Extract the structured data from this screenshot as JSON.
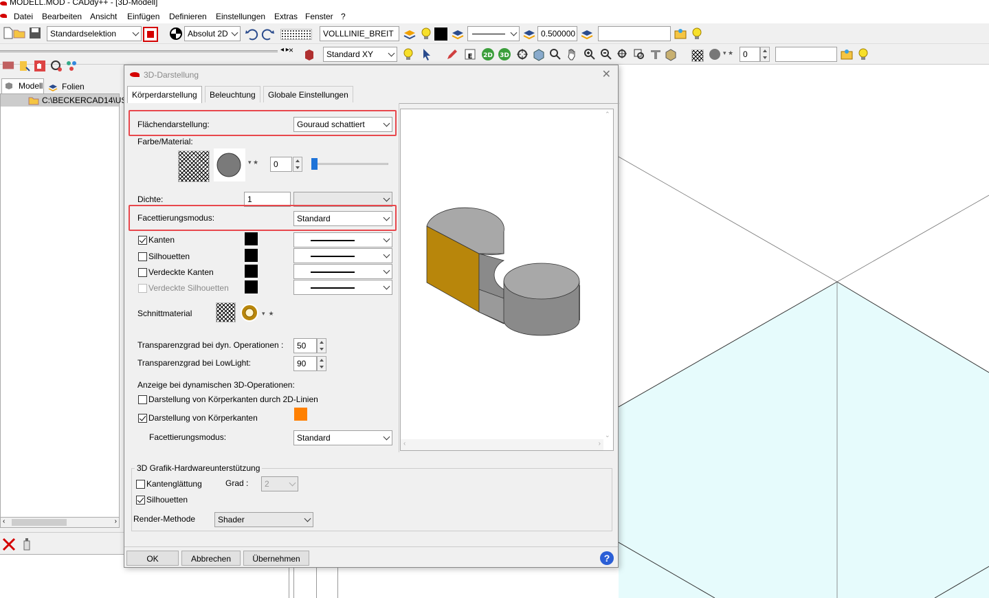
{
  "app": {
    "title": "MODELL.MOD  -  CADdy++ - [3D-Modell]"
  },
  "menu": [
    "Datei",
    "Bearbeiten",
    "Ansicht",
    "Einfügen",
    "Definieren",
    "Einstellungen",
    "Extras",
    "Fenster",
    "?"
  ],
  "toolbar": {
    "selection": "Standardselektion",
    "coord_mode": "Absolut 2D",
    "linestyle": "VOLLLINIE_BREIT",
    "linewidth": "0.500000",
    "view": "Standard XY",
    "layer_value": "0"
  },
  "left_panel": {
    "tabs": [
      "Modell",
      "Folien"
    ],
    "tree_item": "C:\\BECKERCAD14\\US"
  },
  "dialog": {
    "title": "3D-Darstellung",
    "tabs": [
      "Körperdarstellung",
      "Beleuchtung",
      "Globale Einstellungen"
    ],
    "flaechen_label": "Flächendarstellung:",
    "flaechen_value": "Gouraud schattiert",
    "farbe_label": "Farbe/Material:",
    "farbe_value": "0",
    "dichte_label": "Dichte:",
    "dichte_value": "1",
    "facett_label": "Facettierungsmodus:",
    "facett_value": "Standard",
    "kanten": "Kanten",
    "silhouetten": "Silhouetten",
    "verdeckte_kanten": "Verdeckte Kanten",
    "verdeckte_silhouetten": "Verdeckte Silhouetten",
    "schnittmaterial": "Schnittmaterial",
    "transp_dyn_label": "Transparenzgrad bei dyn. Operationen :",
    "transp_dyn_value": "50",
    "transp_low_label": "Transparenzgrad bei LowLight:",
    "transp_low_value": "90",
    "anzeige_label": "Anzeige bei dynamischen 3D-Operationen:",
    "darst_2d": "Darstellung von Körperkanten durch 2D-Linien",
    "darst_kanten": "Darstellung von Körperkanten",
    "facett2_label": "Facettierungsmodus:",
    "facett2_value": "Standard",
    "hw_group": "3D Grafik-Hardwareunterstützung",
    "kantenglaettung": "Kantenglättung",
    "grad_label": "Grad :",
    "grad_value": "2",
    "hw_silhouetten": "Silhouetten",
    "render_label": "Render-Methode",
    "render_value": "Shader",
    "ok": "OK",
    "abbrechen": "Abbrechen",
    "uebernehmen": "Übernehmen",
    "help": "?"
  },
  "colors": {
    "accent_orange": "#ff8000",
    "highlight": "#e8474c",
    "cut_face": "#b8860b",
    "canvas_fill": "#e6fbfc"
  }
}
